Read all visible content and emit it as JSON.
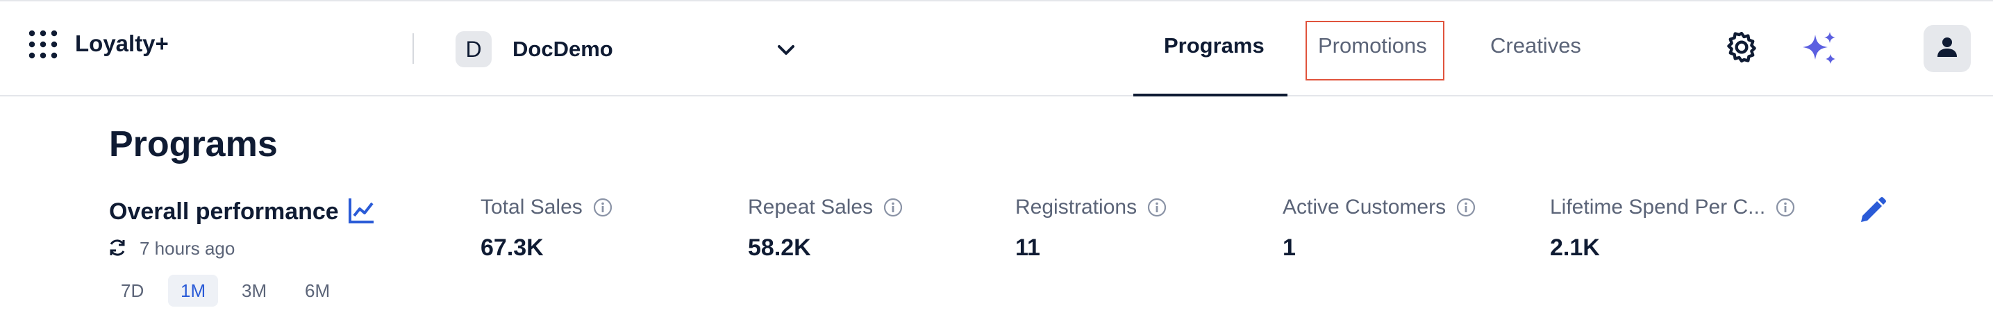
{
  "header": {
    "app_title": "Loyalty+",
    "tenant": {
      "initial": "D",
      "name": "DocDemo"
    },
    "tabs": [
      {
        "label": "Programs",
        "active": true
      },
      {
        "label": "Promotions",
        "active": false
      },
      {
        "label": "Creatives",
        "active": false
      }
    ],
    "icons": [
      "apps-grid-icon",
      "chevron-down-icon",
      "gear-icon",
      "sparkle-icon",
      "user-icon"
    ],
    "accent_color": "#2a5bd7",
    "highlight_color": "#e0533c"
  },
  "page": {
    "title": "Programs",
    "performance": {
      "title": "Overall performance",
      "updated": "7 hours ago",
      "ranges": [
        {
          "label": "7D",
          "active": false
        },
        {
          "label": "1M",
          "active": true
        },
        {
          "label": "3M",
          "active": false
        },
        {
          "label": "6M",
          "active": false
        }
      ]
    },
    "metrics": [
      {
        "label": "Total Sales",
        "value": "67.3K"
      },
      {
        "label": "Repeat Sales",
        "value": "58.2K"
      },
      {
        "label": "Registrations",
        "value": "11"
      },
      {
        "label": "Active Customers",
        "value": "1"
      },
      {
        "label": "Lifetime Spend Per C...",
        "value": "2.1K"
      }
    ]
  }
}
